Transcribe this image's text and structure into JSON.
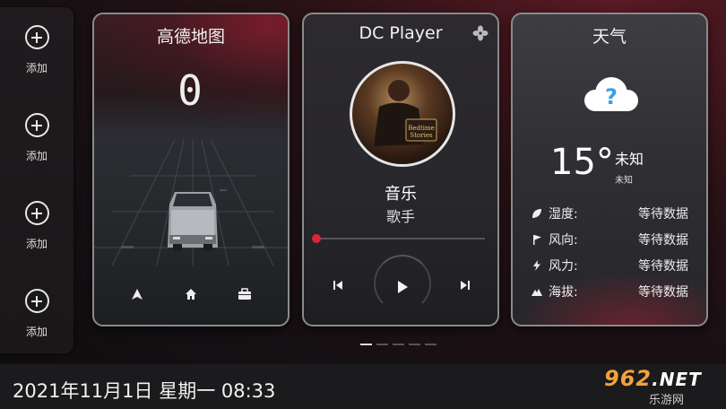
{
  "sidebar": {
    "items": [
      {
        "label": "添加"
      },
      {
        "label": "添加"
      },
      {
        "label": "添加"
      },
      {
        "label": "添加"
      }
    ]
  },
  "map_card": {
    "title": "高德地图",
    "speed": "0"
  },
  "player_card": {
    "title": "DC Player",
    "song": "音乐",
    "artist": "歌手",
    "progress": 0.0
  },
  "weather_card": {
    "title": "天气",
    "temperature": "15°",
    "condition": "未知",
    "condition_sub": "未知",
    "rows": [
      {
        "label": "湿度:",
        "value": "等待数据",
        "icon": "leaf-icon"
      },
      {
        "label": "风向:",
        "value": "等待数据",
        "icon": "flag-icon"
      },
      {
        "label": "风力:",
        "value": "等待数据",
        "icon": "bolt-icon"
      },
      {
        "label": "海拔:",
        "value": "等待数据",
        "icon": "mountain-icon"
      }
    ]
  },
  "pager": {
    "count": 5,
    "active": 0
  },
  "footer": {
    "datetime": "2021年11月1日 星期一 08:33"
  },
  "watermark": {
    "main": "962",
    "net": ".NET",
    "sub": "乐游网"
  },
  "colors": {
    "accent": "#e0233a",
    "card_border": "#8a8a8c",
    "cloud": "#ffffff",
    "question": "#3aa0e8"
  }
}
